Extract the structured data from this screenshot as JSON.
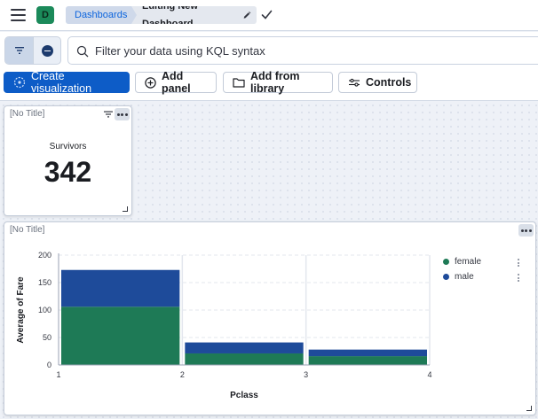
{
  "header": {
    "space_initial": "D",
    "breadcrumbs": [
      "Dashboards",
      "Editing New Dashboard"
    ]
  },
  "query": {
    "placeholder": "Filter your data using KQL syntax"
  },
  "toolbar": {
    "create_label": "Create visualization",
    "add_panel_label": "Add panel",
    "add_library_label": "Add from library",
    "controls_label": "Controls"
  },
  "panels": [
    {
      "title": "[No Title]",
      "metric_label": "Survivors",
      "metric_value": "342"
    },
    {
      "title": "[No Title]",
      "legend": [
        {
          "name": "female",
          "color": "#1e7a56"
        },
        {
          "name": "male",
          "color": "#1e4b9a"
        }
      ]
    }
  ],
  "chart_data": {
    "type": "bar",
    "stacked": true,
    "xlabel": "Pclass",
    "ylabel": "Average of Fare",
    "x_ticks": [
      "1",
      "2",
      "3",
      "4"
    ],
    "bins": [
      {
        "from": 1,
        "to": 2
      },
      {
        "from": 2,
        "to": 3
      },
      {
        "from": 3,
        "to": 4
      }
    ],
    "series": [
      {
        "name": "female",
        "values": [
          106,
          21,
          16
        ]
      },
      {
        "name": "male",
        "values": [
          67,
          20,
          12
        ]
      }
    ],
    "ylim": [
      0,
      200
    ],
    "y_ticks": [
      0,
      50,
      100,
      150,
      200
    ],
    "legend_position": "right",
    "colors": {
      "female": "#1e7a56",
      "male": "#1e4b9a"
    }
  }
}
